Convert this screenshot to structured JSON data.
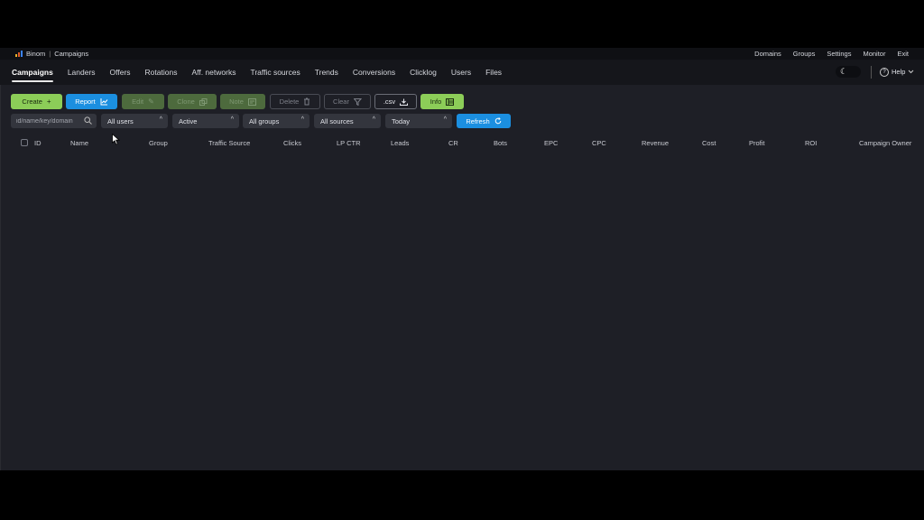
{
  "topbar": {
    "brand": "Binom",
    "page": "Campaigns",
    "links": [
      "Domains",
      "Groups",
      "Settings",
      "Monitor",
      "Exit"
    ],
    "logo_colors": [
      "#e9b02b",
      "#e05b2a",
      "#3b82f6"
    ]
  },
  "nav": {
    "tabs": [
      "Campaigns",
      "Landers",
      "Offers",
      "Rotations",
      "Aff. networks",
      "Traffic sources",
      "Trends",
      "Conversions",
      "Clicklog",
      "Users",
      "Files"
    ],
    "active_tab": "Campaigns",
    "help_label": "Help",
    "theme_icon": "moon-icon"
  },
  "toolbar": {
    "create": "Create",
    "report": "Report",
    "edit": "Edit",
    "clone": "Clone",
    "note": "Note",
    "delete": "Delete",
    "clear": "Clear",
    "csv": ".csv",
    "info": "Info"
  },
  "filters": {
    "search_placeholder": "id/name/key/domain",
    "users": "All users",
    "status": "Active",
    "groups": "All groups",
    "sources": "All sources",
    "period": "Today",
    "refresh": "Refresh"
  },
  "table": {
    "columns": [
      "ID",
      "Name",
      "Group",
      "Traffic Source",
      "Clicks",
      "LP CTR",
      "Leads",
      "CR",
      "Bots",
      "EPC",
      "CPC",
      "Revenue",
      "Cost",
      "Profit",
      "ROI",
      "Campaign Owner"
    ],
    "rows": []
  },
  "colors": {
    "green": "#8ccd58",
    "blue": "#1b8fe0",
    "background": "#1e1f26"
  }
}
